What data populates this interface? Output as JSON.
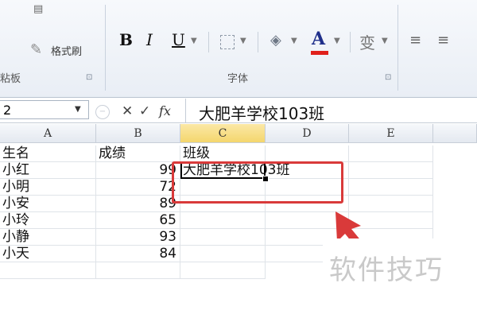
{
  "ribbon": {
    "clipboard": {
      "format_painter_label": "格式刷",
      "group_label": "粘板"
    },
    "font": {
      "bold_label": "B",
      "italic_label": "I",
      "underline_label": "U",
      "font_color_label": "A",
      "wen_label": "变",
      "group_label": "字体"
    }
  },
  "formula_bar": {
    "name_box_value": "2",
    "cancel_label": "✕",
    "enter_label": "✓",
    "fx_label": "fx",
    "content": "大肥羊学校103班"
  },
  "sheet": {
    "columns": [
      "A",
      "B",
      "C",
      "D",
      "E"
    ],
    "active_column": "C",
    "rows": [
      {
        "a": "生名",
        "b": "成绩",
        "c": "班级"
      },
      {
        "a": "小红",
        "b": "99",
        "c": "大肥羊学校103班"
      },
      {
        "a": "小明",
        "b": "72",
        "c": ""
      },
      {
        "a": "小安",
        "b": "89",
        "c": ""
      },
      {
        "a": "小玲",
        "b": "65",
        "c": ""
      },
      {
        "a": "小静",
        "b": "93",
        "c": ""
      },
      {
        "a": "小天",
        "b": "84",
        "c": ""
      }
    ]
  },
  "watermark": "软件技巧",
  "colors": {
    "annotation": "#d93a3a",
    "active_header": "#f4d66d",
    "font_color_bar": "#e0201b"
  }
}
